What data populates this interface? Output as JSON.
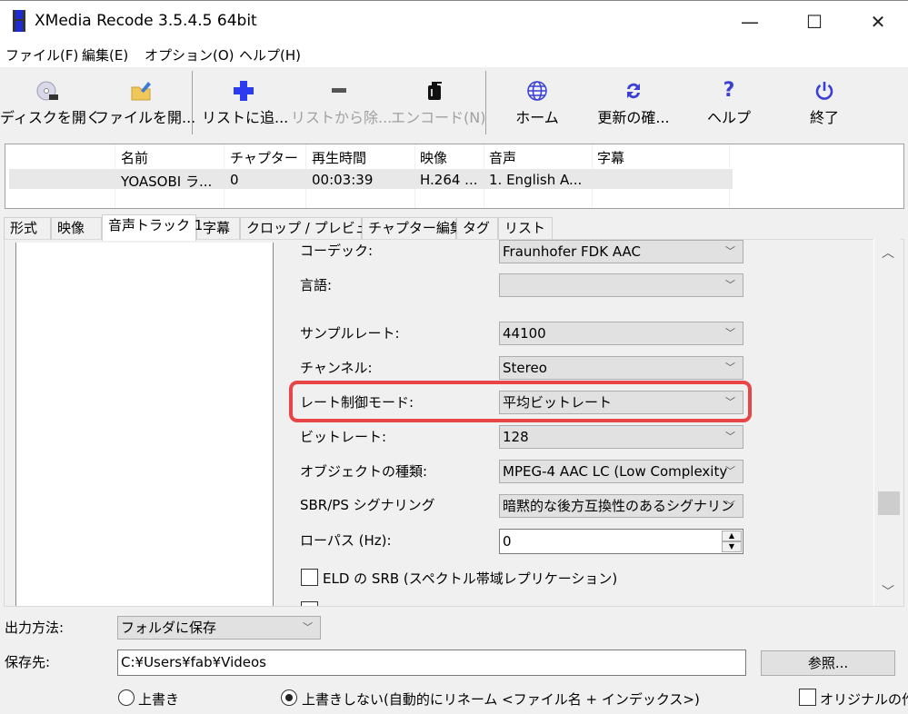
{
  "window": {
    "title": "XMedia Recode 3.5.4.5 64bit",
    "controls": {
      "minimize": "—",
      "maximize": "☐",
      "close": "✕"
    }
  },
  "menu": [
    "ファイル(F)",
    "編集(E)",
    "オプション(O)",
    "ヘルプ(H)"
  ],
  "toolbar": {
    "buttons": [
      {
        "label": "ディスクを開く",
        "icon": "disc-icon",
        "enabled": true
      },
      {
        "label": "ファイルを開...",
        "icon": "open-folder-icon",
        "enabled": true
      },
      {
        "label": "リストに追...",
        "icon": "plus-icon",
        "enabled": true
      },
      {
        "label": "リストから除...",
        "icon": "minus-icon",
        "enabled": false
      },
      {
        "label": "エンコード(N)",
        "icon": "encode-icon",
        "enabled": false
      },
      {
        "label": "ホーム",
        "icon": "globe-icon",
        "enabled": true
      },
      {
        "label": "更新の確...",
        "icon": "refresh-icon",
        "enabled": true
      },
      {
        "label": "ヘルプ",
        "icon": "question-icon",
        "enabled": true
      },
      {
        "label": "終了",
        "icon": "power-icon",
        "enabled": true
      }
    ]
  },
  "filelist": {
    "columns": [
      "名前",
      "チャプター",
      "再生時間",
      "映像",
      "音声",
      "字幕"
    ],
    "rows": [
      {
        "name": "YOASOBI ラ...",
        "chapters": "0",
        "duration": "00:03:39",
        "video": "H.264 ...",
        "audio": "1. English A...",
        "subtitle": ""
      }
    ]
  },
  "tabs": [
    {
      "label": "形式",
      "active": false
    },
    {
      "label": "映像",
      "active": false
    },
    {
      "label": "音声トラック 1",
      "active": true
    },
    {
      "label": "字幕",
      "active": false
    },
    {
      "label": "クロップ / プレビュー",
      "active": false
    },
    {
      "label": "チャプター編集",
      "active": false
    },
    {
      "label": "タグ",
      "active": false
    },
    {
      "label": "リスト",
      "active": false
    }
  ],
  "audio_settings": {
    "codec": {
      "label": "コーデック:",
      "value": "Fraunhofer FDK AAC"
    },
    "language": {
      "label": "言語:",
      "value": ""
    },
    "sample_rate": {
      "label": "サンプルレート:",
      "value": "44100"
    },
    "channels": {
      "label": "チャンネル:",
      "value": "Stereo"
    },
    "rate_control": {
      "label": "レート制御モード:",
      "value": "平均ビットレート",
      "highlighted": true,
      "highlight_color": "#e84646"
    },
    "bitrate": {
      "label": "ビットレート:",
      "value": "128"
    },
    "object_type": {
      "label": "オブジェクトの種類:",
      "value": "MPEG-4 AAC LC (Low Complexity"
    },
    "sbr_ps": {
      "label": "SBR/PS シグナリング",
      "value": "暗黙的な後方互換性のあるシグナリン"
    },
    "lowpass": {
      "label": "ローパス (Hz):",
      "value": "0"
    },
    "eld_sbr": {
      "label": "ELD の SRB (スペクトル帯域レプリケーション)",
      "checked": false
    }
  },
  "output": {
    "method_label": "出力方法:",
    "method_value": "フォルダに保存",
    "dest_label": "保存先:",
    "dest_value": "C:¥Users¥fab¥Videos",
    "browse_label": "参照...",
    "overwrite_label": "上書き",
    "no_overwrite_label": "上書きしない(自動的にリネーム <ファイル名 + インデックス>)",
    "overwrite_selected": "no_overwrite",
    "keep_original_label": "オリジナルの作成",
    "keep_original_checked": false
  }
}
